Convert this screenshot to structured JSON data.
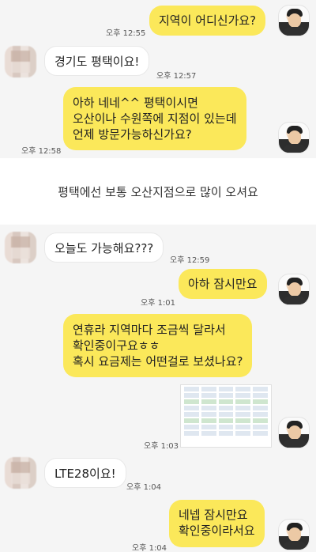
{
  "messages": [
    {
      "text": "지역이 어디신가요?",
      "time": "오후 12:55"
    },
    {
      "text": "경기도 평택이요!",
      "time": "오후 12:57"
    },
    {
      "lines": [
        "아하 네네^^ 평택이시면",
        "오산이나 수원쪽에 지점이 있는데",
        "언제 방문가능하신가요?"
      ],
      "time": "오후 12:58"
    },
    {
      "text": "오늘도 가능해요???",
      "time": "오후 12:59"
    },
    {
      "text": "아하 잠시만요",
      "time": "오후 1:01"
    },
    {
      "lines": [
        "연휴라 지역마다 조금씩 달라서",
        "확인중이구요ㅎㅎ",
        "혹시 요금제는 어떤걸로 보셨나요?"
      ]
    },
    {
      "time": "오후 1:03"
    },
    {
      "text": "LTE28이요!",
      "time": "오후 1:04"
    },
    {
      "lines": [
        "네넵 잠시만요",
        "확인중이라서요"
      ],
      "time": "오후 1:04"
    }
  ],
  "banner": {
    "text": "평택에선 보통 오산지점으로 많이 오셔요"
  }
}
